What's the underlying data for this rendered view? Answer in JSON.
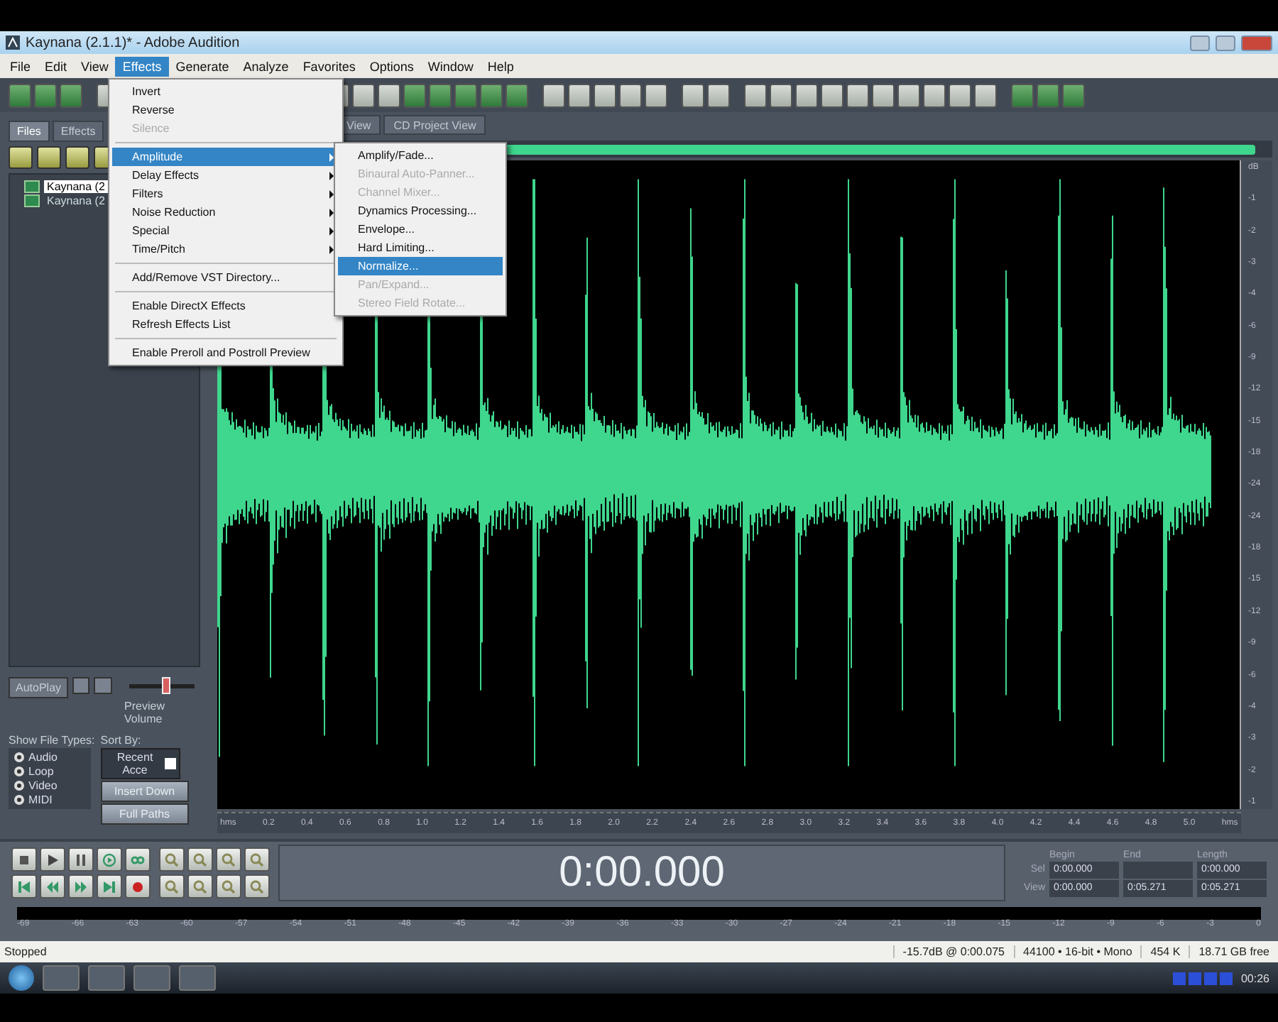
{
  "window": {
    "title": "Kaynana (2.1.1)* - Adobe Audition"
  },
  "menu_bar": [
    {
      "label": "File",
      "selected": false
    },
    {
      "label": "Edit",
      "selected": false
    },
    {
      "label": "View",
      "selected": false
    },
    {
      "label": "Effects",
      "selected": true
    },
    {
      "label": "Generate",
      "selected": false
    },
    {
      "label": "Analyze",
      "selected": false
    },
    {
      "label": "Favorites",
      "selected": false
    },
    {
      "label": "Options",
      "selected": false
    },
    {
      "label": "Window",
      "selected": false
    },
    {
      "label": "Help",
      "selected": false
    }
  ],
  "effects_menu": [
    {
      "kind": "item",
      "label": "Invert",
      "disabled": false,
      "selected": false
    },
    {
      "kind": "item",
      "label": "Reverse",
      "disabled": false,
      "selected": false
    },
    {
      "kind": "item",
      "label": "Silence",
      "disabled": true,
      "selected": false
    },
    {
      "kind": "separator"
    },
    {
      "kind": "submenu",
      "label": "Amplitude",
      "disabled": false,
      "selected": true
    },
    {
      "kind": "submenu",
      "label": "Delay Effects",
      "disabled": false,
      "selected": false
    },
    {
      "kind": "submenu",
      "label": "Filters",
      "disabled": false,
      "selected": false
    },
    {
      "kind": "submenu",
      "label": "Noise Reduction",
      "disabled": false,
      "selected": false
    },
    {
      "kind": "submenu",
      "label": "Special",
      "disabled": false,
      "selected": false
    },
    {
      "kind": "submenu",
      "label": "Time/Pitch",
      "disabled": false,
      "selected": false
    },
    {
      "kind": "separator"
    },
    {
      "kind": "item",
      "label": "Add/Remove VST Directory...",
      "disabled": false,
      "selected": false
    },
    {
      "kind": "separator"
    },
    {
      "kind": "item",
      "label": "Enable DirectX Effects",
      "disabled": false,
      "selected": false
    },
    {
      "kind": "item",
      "label": "Refresh Effects List",
      "disabled": false,
      "selected": false
    },
    {
      "kind": "separator"
    },
    {
      "kind": "item",
      "label": "Enable Preroll and Postroll Preview",
      "disabled": false,
      "selected": false
    }
  ],
  "amplitude_submenu": [
    {
      "label": "Amplify/Fade...",
      "disabled": false,
      "selected": false
    },
    {
      "label": "Binaural Auto-Panner...",
      "disabled": true,
      "selected": false
    },
    {
      "label": "Channel Mixer...",
      "disabled": true,
      "selected": false
    },
    {
      "label": "Dynamics Processing...",
      "disabled": false,
      "selected": false
    },
    {
      "label": "Envelope...",
      "disabled": false,
      "selected": false
    },
    {
      "label": "Hard Limiting...",
      "disabled": false,
      "selected": false
    },
    {
      "label": "Normalize...",
      "disabled": false,
      "selected": true
    },
    {
      "label": "Pan/Expand...",
      "disabled": true,
      "selected": false
    },
    {
      "label": "Stereo Field Rotate...",
      "disabled": true,
      "selected": false
    }
  ],
  "left_panel": {
    "tabs": [
      {
        "label": "Files",
        "selected": true
      },
      {
        "label": "Effects",
        "selected": false
      }
    ],
    "files": [
      {
        "name": "Kaynana (2",
        "selected": true
      },
      {
        "name": "Kaynana (2",
        "selected": false
      }
    ],
    "autoplay_button": "AutoPlay",
    "preview_volume": {
      "label": "Preview Volume",
      "level": 0.55
    },
    "show_file_types_label": "Show File Types:",
    "file_types": [
      {
        "label": "Audio",
        "checked": true
      },
      {
        "label": "Loop",
        "checked": true
      },
      {
        "label": "Video",
        "checked": true
      },
      {
        "label": "MIDI",
        "checked": true
      }
    ],
    "sort_by_label": "Sort By:",
    "sort_by": "Recent Acce",
    "buttons": [
      "Insert Down",
      "Full Paths"
    ]
  },
  "view_tabs": [
    {
      "label": "View"
    },
    {
      "label": "CD Project View"
    }
  ],
  "waveform": {
    "ruler": [
      "hms",
      "0.2",
      "0.4",
      "0.6",
      "0.8",
      "1.0",
      "1.2",
      "1.4",
      "1.6",
      "1.8",
      "2.0",
      "2.2",
      "2.4",
      "2.6",
      "2.8",
      "3.0",
      "3.2",
      "3.4",
      "3.6",
      "3.8",
      "4.0",
      "4.2",
      "4.4",
      "4.6",
      "4.8",
      "5.0",
      "hms"
    ],
    "db_scale": [
      "dB",
      "-1",
      "-2",
      "-3",
      "-4",
      "-6",
      "-9",
      "-12",
      "-15",
      "-18",
      "-24",
      "-24",
      "-18",
      "-15",
      "-12",
      "-9",
      "-6",
      "-4",
      "-3",
      "-2",
      "-1"
    ]
  },
  "transport": {
    "time": "0:00.000"
  },
  "selection": {
    "headers": [
      "Begin",
      "End",
      "Length"
    ],
    "rows": [
      {
        "label": "Sel",
        "begin": "0:00.000",
        "length": "0:00.000"
      },
      {
        "label": "View",
        "begin": "0:00.000",
        "end": "0:05.271",
        "length": "0:05.271"
      }
    ]
  },
  "level_meter": {
    "scale": [
      "-69",
      "-66",
      "-63",
      "-60",
      "-57",
      "-54",
      "-51",
      "-48",
      "-45",
      "-42",
      "-39",
      "-36",
      "-33",
      "-30",
      "-27",
      "-24",
      "-21",
      "-18",
      "-15",
      "-12",
      "-9",
      "-6",
      "-3",
      "0"
    ]
  },
  "status_bar": {
    "state": "Stopped",
    "fields": [
      "-15.7dB @ 0:00.075",
      "44100 • 16-bit • Mono",
      "454 K",
      "18.71 GB free"
    ]
  },
  "taskbar": {
    "clock": "00:26"
  }
}
